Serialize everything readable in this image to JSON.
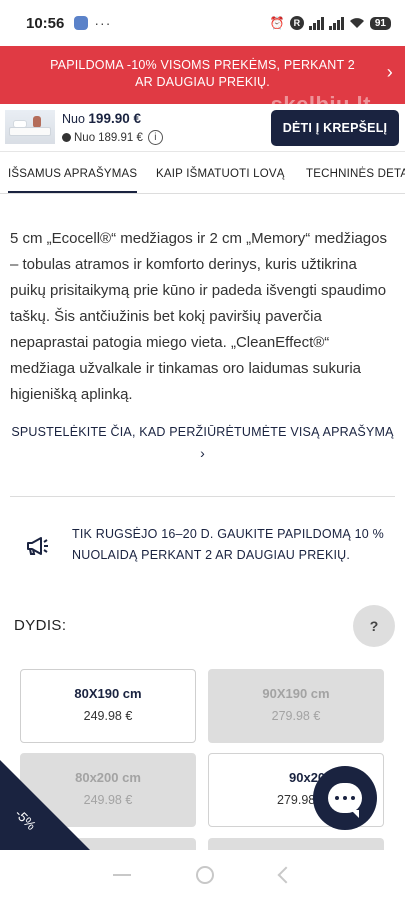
{
  "status_bar": {
    "time": "10:56",
    "dots": "···",
    "alarm_glyph": "⏰",
    "r_badge": "R",
    "battery": "91"
  },
  "banner": {
    "text": "PAPILDOMA -10% VISOMS PREKĖMS, PERKANT 2 AR DAUGIAU PREKIŲ.",
    "chevron": "›",
    "watermark": "skelbiu.lt"
  },
  "buy_bar": {
    "price_prefix": "Nuo",
    "price": "199.90 €",
    "loyalty_prefix": "Nuo",
    "loyalty_price": "189.91 €",
    "info_glyph": "i",
    "add_to_cart_label": "DĖTI Į KREPŠELĮ"
  },
  "tabs": [
    {
      "label": "IŠSAMUS APRAŠYMAS",
      "active": true
    },
    {
      "label": "KAIP IŠMATUOTI LOVĄ",
      "active": false
    },
    {
      "label": "TECHNINĖS DETA",
      "active": false
    }
  ],
  "description": {
    "text": "5 cm „Ecocell®“ medžiagos ir 2 cm „Memory“ medžiagos – tobulas atramos ir komforto derinys, kuris užtikrina puikų prisitaikymą prie kūno ir padeda išvengti spaudimo taškų. Šis antčiužinis bet kokį paviršių paverčia nepaprastai patogia miego vieta. „CleanEffect®“ medžiaga užvalkale ir tinkamas oro laidumas sukuria higienišką aplinką.",
    "read_more": "SPUSTELĖKITE ČIA, KAD PERŽIŪRĖTUMĖTE VISĄ APRAŠYMĄ",
    "read_more_chevron": "›"
  },
  "notice": {
    "icon": "megaphone-icon",
    "text": "TIK RUGSĖJO 16–20 D. GAUKITE PAPILDOMĄ 10 % NUOLAIDĄ PERKANT 2 AR DAUGIAU PREKIŲ."
  },
  "size_section": {
    "label": "DYDIS:",
    "help_glyph": "?",
    "options": [
      {
        "size": "80X190 cm",
        "price": "249.98 €",
        "state": "selected"
      },
      {
        "size": "90X190 cm",
        "price": "279.98 €",
        "state": "unavailable"
      },
      {
        "size": "80x200 cm",
        "price": "249.98 €",
        "state": "unavailable"
      },
      {
        "size": "90x200 cm",
        "price": "279.98 €",
        "state": "available"
      }
    ]
  },
  "discount_badge": {
    "label": "-5%"
  },
  "colors": {
    "brand_navy": "#1a2340",
    "banner_red": "#e03a44",
    "disabled_gray": "#dddddd"
  }
}
